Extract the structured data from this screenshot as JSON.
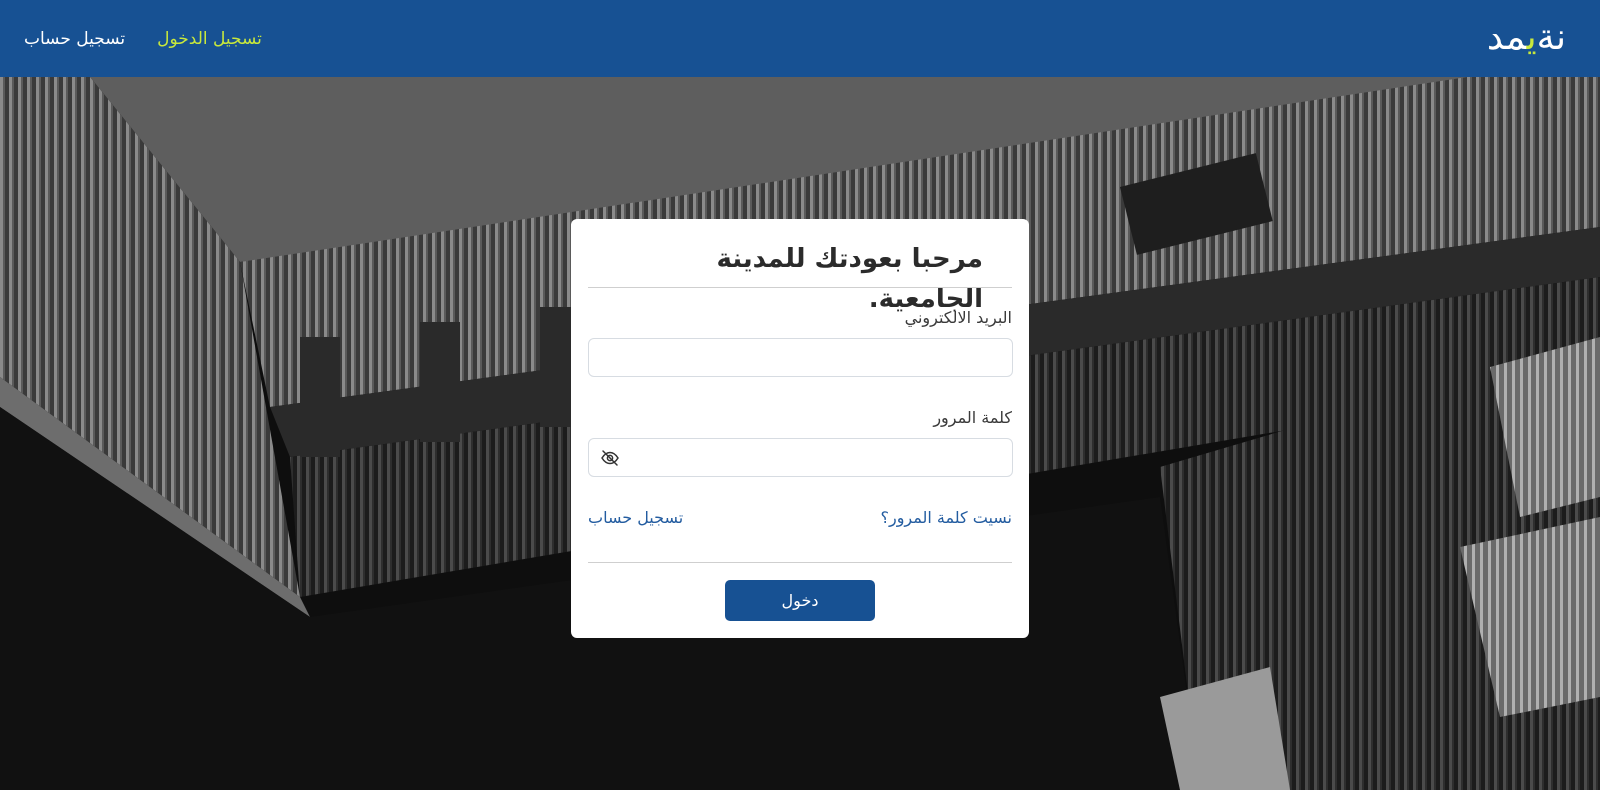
{
  "brand": {
    "first": "مد",
    "accent": "ي",
    "rest": "نة",
    "display": "مدينة"
  },
  "nav": {
    "login_label": "تسجيل الدخول",
    "register_label": "تسجيل حساب"
  },
  "card": {
    "title": "مرحبا بعودتك للمدينة الجامعية.",
    "email_label": "البريد الالكتروني",
    "email_value": "",
    "password_label": "كلمة المرور",
    "password_value": "",
    "forgot_label": "نسيت كلمة المرور؟",
    "register_label": "تسجيل حساب",
    "submit_label": "دخول"
  },
  "colors": {
    "navbar": "#175193",
    "accent": "#c8e83c",
    "link": "#235ca0",
    "button": "#175193"
  },
  "icons": {
    "password_toggle": "eye-slash-icon"
  }
}
